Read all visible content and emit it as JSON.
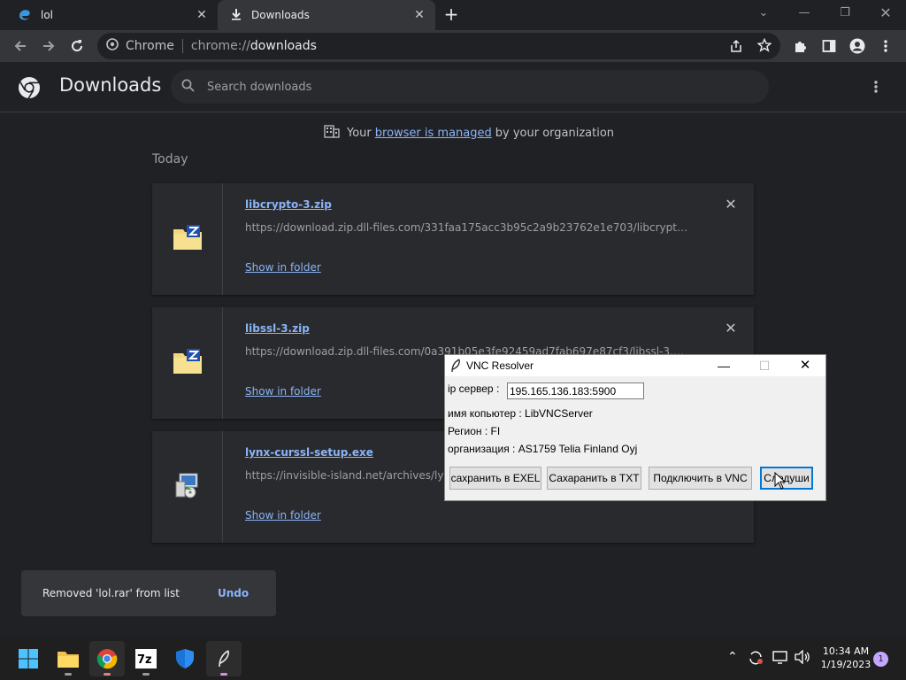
{
  "tabs": [
    {
      "title": "lol",
      "close": "✕"
    },
    {
      "title": "Downloads",
      "close": "✕"
    }
  ],
  "new_tab_label": "+",
  "omnibox": {
    "chip": "Chrome",
    "scheme": "chrome://",
    "host": "downloads"
  },
  "downloads": {
    "title": "Downloads",
    "search_placeholder": "Search downloads",
    "managed": {
      "prefix": "Your",
      "link": "browser is managed",
      "suffix": "by your organization"
    },
    "section_date": "Today",
    "items": [
      {
        "name": "libcrypto-3.zip",
        "url": "https://download.zip.dll-files.com/331faa175acc3b95c2a9b23762e1e703/libcrypto-...",
        "show_in_folder": "Show in folder",
        "icon": "winzip-folder-icon"
      },
      {
        "name": "libssl-3.zip",
        "url": "https://download.zip.dll-files.com/0a391b05e3fe92459ad7fab697e87cf3/libssl-3.zip",
        "show_in_folder": "Show in folder",
        "icon": "winzip-folder-icon"
      },
      {
        "name": "lynx-curssl-setup.exe",
        "url": "https://invisible-island.net/archives/lynx/",
        "show_in_folder": "Show in folder",
        "icon": "installer-icon"
      }
    ],
    "toast": {
      "message": "Removed 'lol.rar' from list",
      "undo": "Undo"
    }
  },
  "vnc_window": {
    "title": "VNC Resolver",
    "ip_label": "ip сервер :",
    "ip_value": "195.165.136.183:5900",
    "computer_name": "имя копьютер : LibVNCServer",
    "region": "Регион : FI",
    "organization": "организация : AS1759 Telia Finland Oyj",
    "buttons": {
      "save_excel": "сахранить в EXEL",
      "save_txt": "Сахаранить в TXT",
      "connect_vnc": "Подключить в VNC",
      "next": "Следуши"
    }
  },
  "taskbar": {
    "time": "10:34 AM",
    "date": "1/19/2023",
    "notifications": "1",
    "apps": [
      "start-icon",
      "file-explorer-icon",
      "chrome-icon",
      "7zip-icon",
      "windows-security-icon",
      "vnc-resolver-icon"
    ]
  },
  "colors": {
    "accent": "#8ab4f8",
    "background": "#202124",
    "card": "#292a2d"
  }
}
